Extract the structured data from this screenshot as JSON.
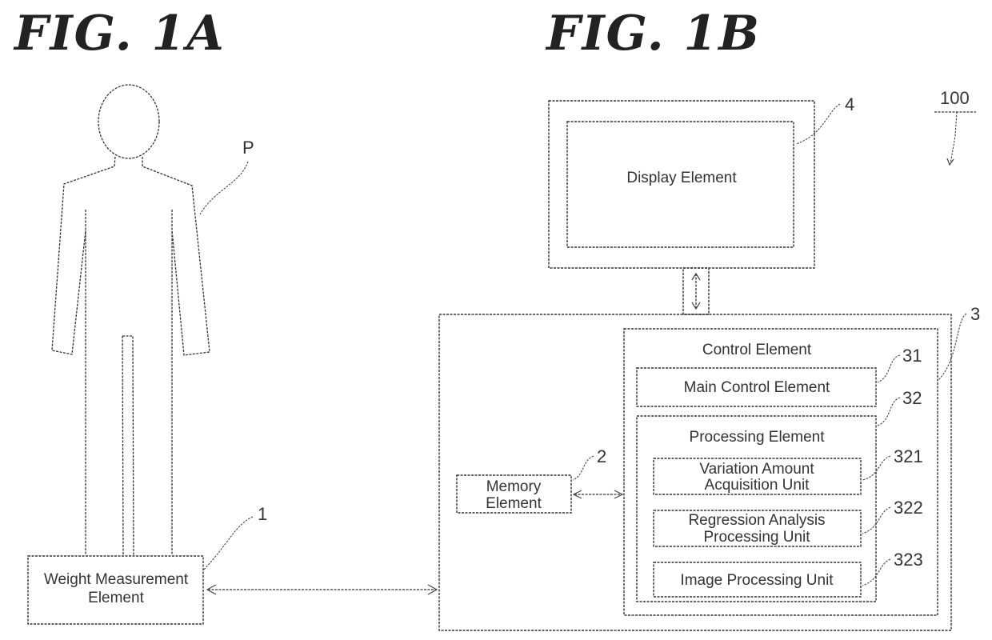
{
  "figures": {
    "fig_1a_title": "FIG. 1A",
    "fig_1b_title": "FIG. 1B"
  },
  "person": {
    "ref": "P"
  },
  "weight_measurement": {
    "label_line1": "Weight Measurement",
    "label_line2": "Element",
    "ref": "1"
  },
  "memory": {
    "label_line1": "Memory",
    "label_line2": "Element",
    "ref": "2"
  },
  "control": {
    "label": "Control Element",
    "ref": "3"
  },
  "main_control": {
    "label": "Main Control Element",
    "ref": "31"
  },
  "processing": {
    "label": "Processing Element",
    "ref": "32"
  },
  "variation_unit": {
    "label_line1": "Variation Amount",
    "label_line2": "Acquisition Unit",
    "ref": "321"
  },
  "regression_unit": {
    "label_line1": "Regression Analysis",
    "label_line2": "Processing Unit",
    "ref": "322"
  },
  "image_unit": {
    "label": "Image Processing Unit",
    "ref": "323"
  },
  "display": {
    "label": "Display Element",
    "ref": "4"
  },
  "system": {
    "ref": "100"
  }
}
